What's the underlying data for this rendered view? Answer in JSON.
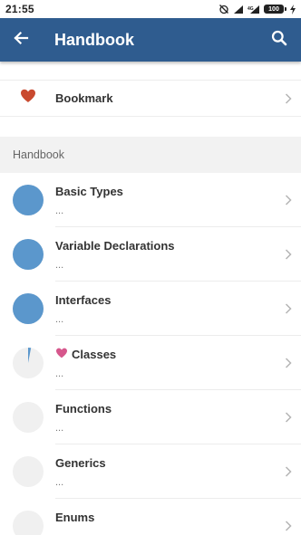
{
  "status_bar": {
    "time": "21:55",
    "battery": "100"
  },
  "app_bar": {
    "title": "Handbook",
    "back_icon": "arrow-left-icon",
    "search_icon": "search-icon"
  },
  "bookmark": {
    "label": "Bookmark",
    "icon": "heart-icon",
    "icon_color": "#c94a2f"
  },
  "section": {
    "header": "Handbook"
  },
  "colors": {
    "app_bar": "#2f5c8f",
    "progress_fill": "#5b97cc",
    "progress_track": "#f0f0f0",
    "favorite_heart": "#d6578c"
  },
  "items": [
    {
      "title": "Basic Types",
      "subtitle": "...",
      "progress": 1.0,
      "favorite": false
    },
    {
      "title": "Variable Declarations",
      "subtitle": "...",
      "progress": 1.0,
      "favorite": false
    },
    {
      "title": "Interfaces",
      "subtitle": "...",
      "progress": 1.0,
      "favorite": false
    },
    {
      "title": "Classes",
      "subtitle": "...",
      "progress": 0.03,
      "favorite": true
    },
    {
      "title": "Functions",
      "subtitle": "...",
      "progress": 0,
      "favorite": false
    },
    {
      "title": "Generics",
      "subtitle": "...",
      "progress": 0,
      "favorite": false
    },
    {
      "title": "Enums",
      "subtitle": "...",
      "progress": 0,
      "favorite": false
    }
  ]
}
